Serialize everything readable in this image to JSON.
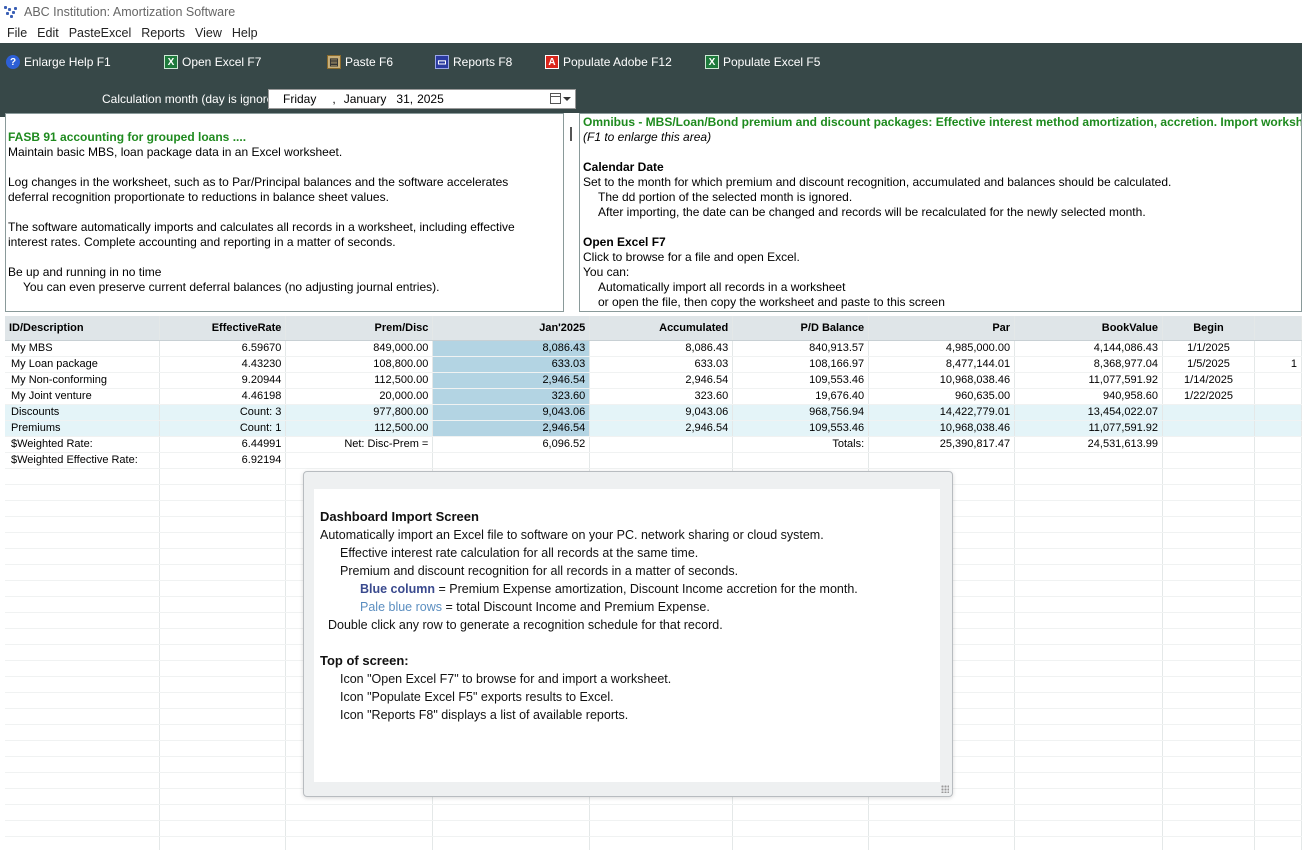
{
  "window": {
    "title": "ABC Institution: Amortization Software",
    "icon": "app-logo-icon"
  },
  "menu": [
    "File",
    "Edit",
    "PasteExcel",
    "Reports",
    "View",
    "Help"
  ],
  "toolbar": {
    "items": [
      {
        "label": "Enlarge Help  F1",
        "icon": "help-icon"
      },
      {
        "label": "Open Excel  F7",
        "icon": "excel-icon"
      },
      {
        "label": "Paste  F6",
        "icon": "paste-icon"
      },
      {
        "label": "Reports  F8",
        "icon": "reports-icon"
      },
      {
        "label": "Populate Adobe  F12",
        "icon": "pdf-icon"
      },
      {
        "label": "Populate Excel  F5",
        "icon": "excel-icon"
      }
    ],
    "calc_label": "Calculation month (day is ignored)",
    "date": {
      "weekday": "Friday",
      "sep": ",",
      "month": "January",
      "day": "31,",
      "year": "2025"
    }
  },
  "left_panel": [
    "FASB 91 accounting for grouped loans ....",
    "Maintain basic MBS, loan package data in an Excel worksheet.",
    "",
    "Log changes in the worksheet, such as to Par/Principal balances and the software accelerates",
    "deferral recognition proportionate to reductions in balance sheet values.",
    "",
    "The software automatically imports and calculates all records in a worksheet, including effective",
    "interest rates.  Complete accounting and reporting in a matter of seconds.",
    "",
    "Be up and running in no time",
    "You can even preserve current deferral balances (no adjusting journal entries)."
  ],
  "right_panel": [
    "Omnibus - MBS/Loan/Bond premium and discount packages: Effective interest method amortization, accretion.  Import workshe",
    "(F1 to enlarge this area)",
    "",
    "Calendar Date",
    "Set to the month for which premium and discount recognition, accumulated and balances should be calculated.",
    "The dd portion of the selected month is ignored.",
    "After importing, the date can be changed and records will be recalculated for the newly selected month.",
    "",
    "Open Excel  F7",
    "Click to browse for a file and open Excel.",
    "You can:",
    "Automatically import all records in a worksheet",
    "or open the file, then copy the worksheet and paste to this screen"
  ],
  "grid": {
    "headers": [
      "ID/Description",
      "EffectiveRate",
      "Prem/Disc",
      "Jan'2025",
      "Accumulated",
      "P/D Balance",
      "Par",
      "BookValue",
      "Begin"
    ],
    "rows": [
      [
        "My MBS",
        "6.59670",
        "849,000.00",
        "8,086.43",
        "8,086.43",
        "840,913.57",
        "4,985,000.00",
        "4,144,086.43",
        "1/1/2025",
        ""
      ],
      [
        "My Loan package",
        "4.43230",
        "108,800.00",
        "633.03",
        "633.03",
        "108,166.97",
        "8,477,144.01",
        "8,368,977.04",
        "1/5/2025",
        "1"
      ],
      [
        "My Non-conforming",
        "9.20944",
        "112,500.00",
        "2,946.54",
        "2,946.54",
        "109,553.46",
        "10,968,038.46",
        "11,077,591.92",
        "1/14/2025",
        ""
      ],
      [
        "My Joint venture",
        "4.46198",
        "20,000.00",
        "323.60",
        "323.60",
        "19,676.40",
        "960,635.00",
        "940,958.60",
        "1/22/2025",
        ""
      ],
      [
        "Discounts",
        "Count: 3",
        "977,800.00",
        "9,043.06",
        "9,043.06",
        "968,756.94",
        "14,422,779.01",
        "13,454,022.07",
        "",
        ""
      ],
      [
        "Premiums",
        "Count: 1",
        "112,500.00",
        "2,946.54",
        "2,946.54",
        "109,553.46",
        "10,968,038.46",
        "11,077,591.92",
        "",
        ""
      ],
      [
        "$Weighted Rate:",
        "6.44991",
        "Net: Disc-Prem =",
        "6,096.52",
        "",
        "Totals:",
        "25,390,817.47",
        "24,531,613.99",
        "",
        ""
      ],
      [
        "$Weighted Effective Rate:",
        "6.92194",
        "",
        "",
        "",
        "",
        "",
        "",
        "",
        ""
      ]
    ]
  },
  "dashboard": {
    "title": "Dashboard Import Screen",
    "line1": "Automatically import an Excel file to software on your PC. network sharing or cloud system.",
    "line2": "Effective interest rate calculation for all records at the same time.",
    "line3": "Premium and discount recognition for all records in a matter of seconds.",
    "blue_col_kw": "Blue column",
    "blue_col_rest": " = Premium Expense amortization, Discount Income accretion for the month.",
    "pale_kw": "Pale blue rows",
    "pale_rest": " = total Discount Income and Premium Expense.",
    "line6": "Double click any row to generate a recognition schedule for that record.",
    "top_title": "Top of screen:",
    "top1": "Icon \"Open Excel F7\" to browse for and import a worksheet.",
    "top2": "Icon \"Populate Excel F5\" exports results to Excel.",
    "top3": "Icon \"Reports F8\" displays a list of available reports."
  },
  "colors": {
    "toolbar_bg": "#374848",
    "blue_column": "#b3d4e3",
    "pale_row": "#e4f4f8",
    "green_heading": "#1e8a1e"
  }
}
